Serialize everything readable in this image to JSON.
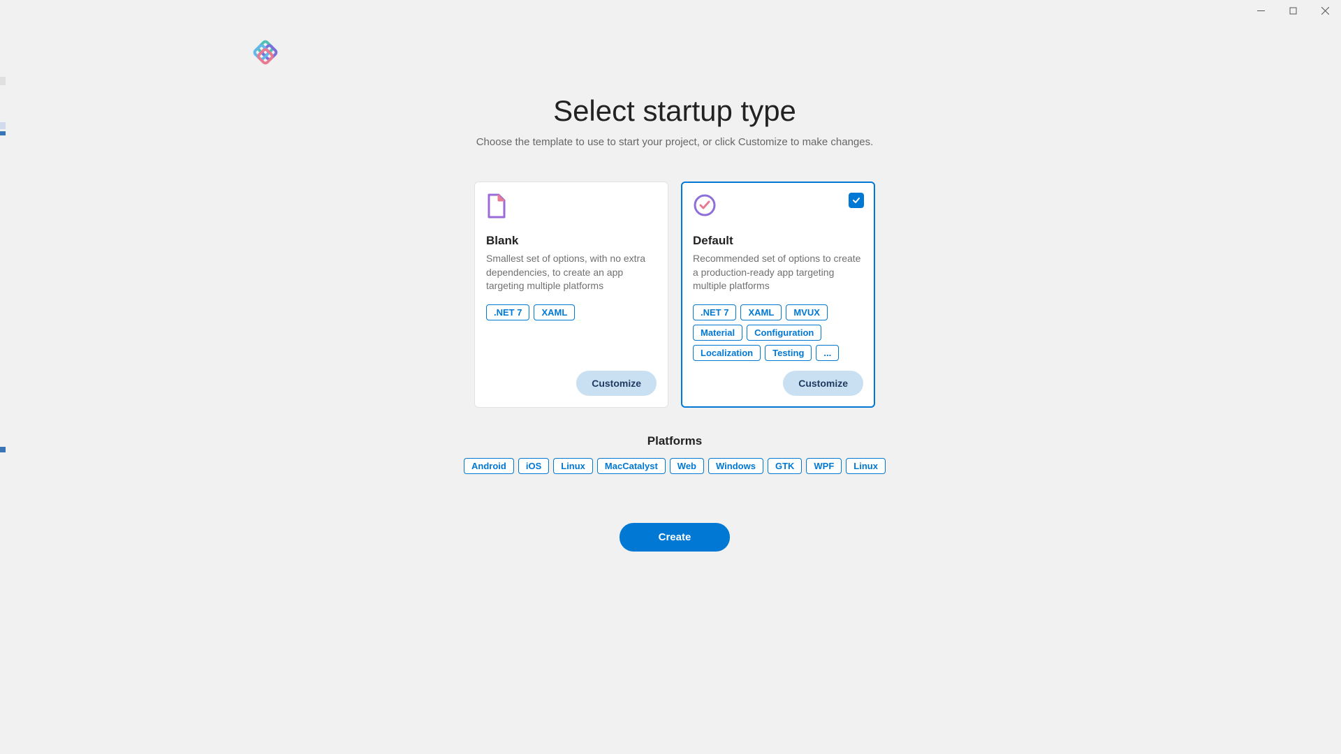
{
  "window_controls": {
    "minimize": "Minimize",
    "maximize": "Maximize",
    "close": "Close"
  },
  "title": "Select startup type",
  "subtitle": "Choose the template to use to start your project, or click Customize to make changes.",
  "cards": [
    {
      "id": "blank",
      "title": "Blank",
      "description": "Smallest set of options, with no extra dependencies, to create an app targeting multiple platforms",
      "tags": [
        ".NET 7",
        "XAML"
      ],
      "selected": false,
      "customize_label": "Customize"
    },
    {
      "id": "default",
      "title": "Default",
      "description": "Recommended set of options to create a production-ready app targeting multiple platforms",
      "tags": [
        ".NET 7",
        "XAML",
        "MVUX",
        "Material",
        "Configuration",
        "Localization",
        "Testing",
        "..."
      ],
      "selected": true,
      "customize_label": "Customize"
    }
  ],
  "platforms": {
    "title": "Platforms",
    "items": [
      "Android",
      "iOS",
      "Linux",
      "MacCatalyst",
      "Web",
      "Windows",
      "GTK",
      "WPF",
      "Linux"
    ]
  },
  "create_label": "Create"
}
